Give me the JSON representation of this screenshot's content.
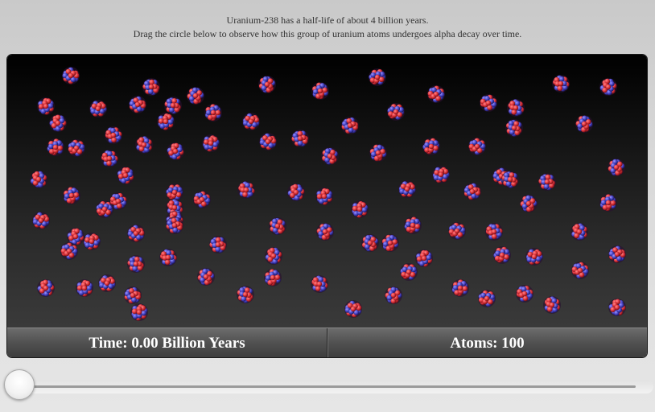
{
  "instructions": {
    "line1": "Uranium-238 has a half-life of about 4 billion years.",
    "line2": "Drag the circle below to observe how this group of uranium atoms undergoes alpha decay over time."
  },
  "readouts": {
    "time_label": "Time: 0.00 Billion Years",
    "atoms_label": "Atoms: 100"
  },
  "simulation": {
    "atom_count": 100,
    "time_billion_years": 0.0
  },
  "slider": {
    "value_fraction": 0.0
  },
  "colors": {
    "proton": "#e0353d",
    "neutron": "#4a46c8",
    "background_top": "#000000",
    "background_bottom": "#3a3a3a"
  }
}
